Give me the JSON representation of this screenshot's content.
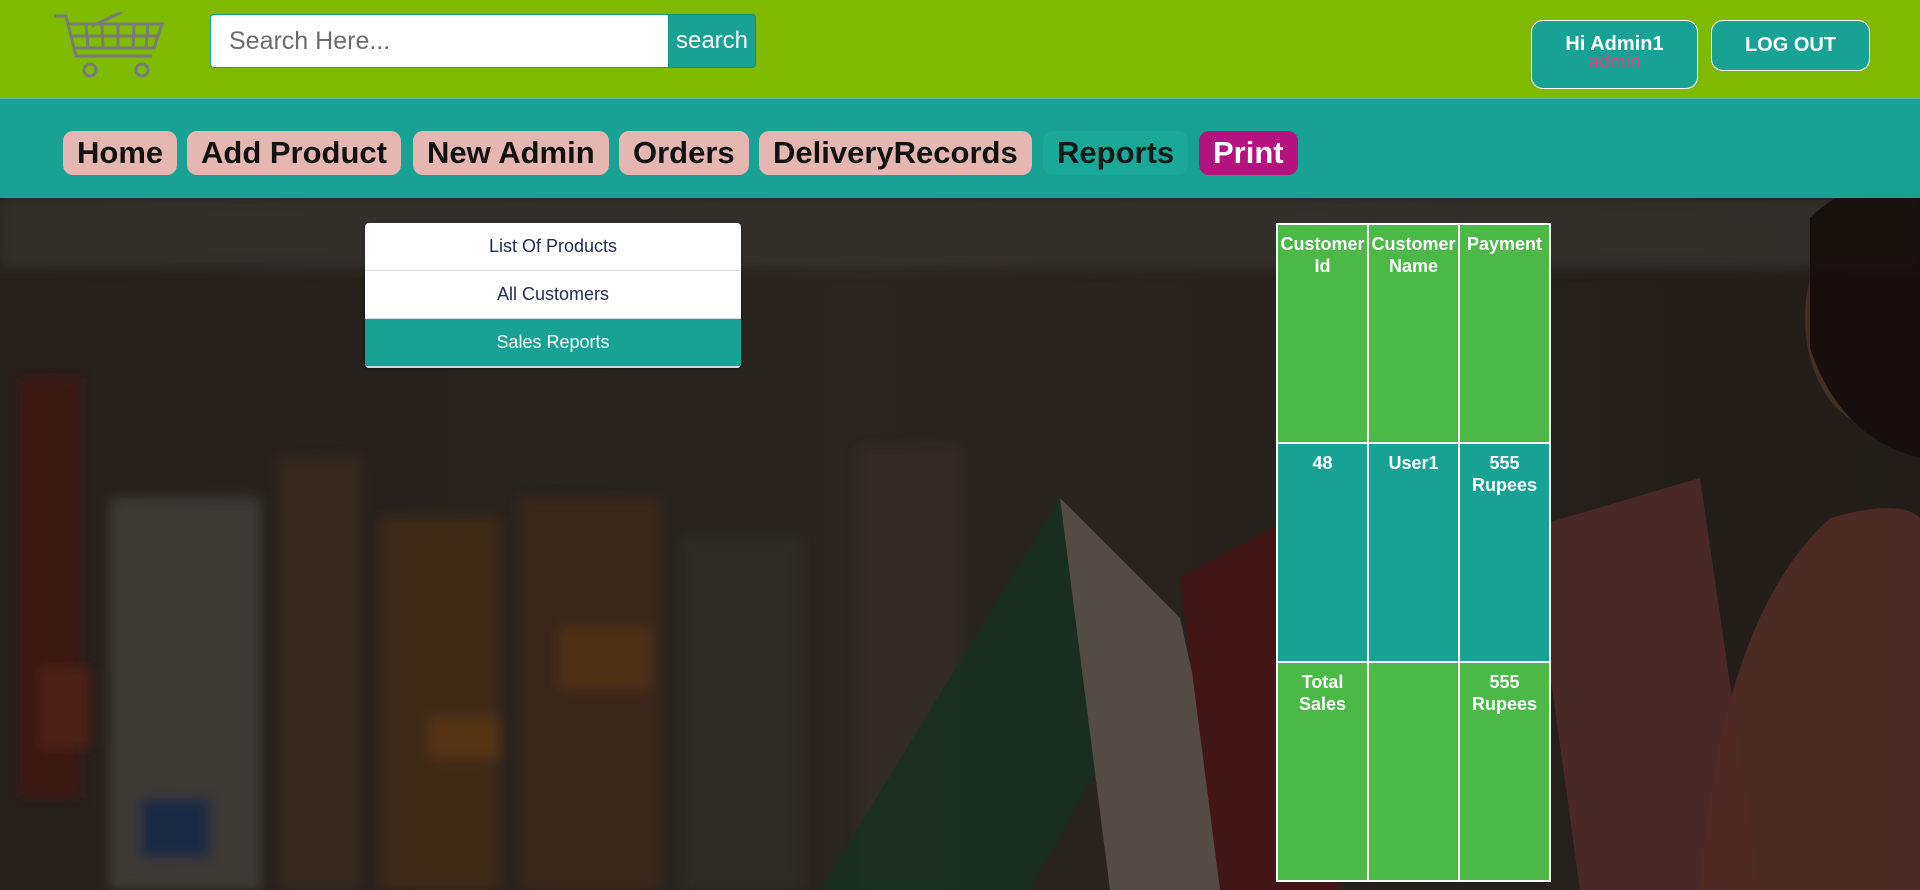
{
  "header": {
    "logo_icon": "shopping-cart-icon",
    "search_placeholder": "Search Here...",
    "search_button": "search",
    "user_greeting": "Hi Admin1",
    "user_role": "admin",
    "logout_label": "LOG OUT"
  },
  "nav": {
    "items": [
      {
        "label": "Home"
      },
      {
        "label": "Add Product"
      },
      {
        "label": "New Admin"
      },
      {
        "label": "Orders"
      },
      {
        "label": "DeliveryRecords"
      },
      {
        "label": "Reports"
      },
      {
        "label": "Print"
      }
    ],
    "active": "Reports"
  },
  "reports_menu": {
    "items": [
      {
        "label": "List Of Products"
      },
      {
        "label": "All Customers"
      },
      {
        "label": "Sales Reports"
      }
    ],
    "selected": "Sales Reports"
  },
  "sales_table": {
    "headers": [
      "Customer Id",
      "Customer Name",
      "Payment"
    ],
    "rows": [
      {
        "customer_id": "48",
        "customer_name": "User1",
        "payment": "555 Rupees"
      }
    ],
    "total_label": "Total Sales",
    "total_value": "555 Rupees"
  },
  "colors": {
    "header_green": "#7fba00",
    "teal": "#17a293",
    "nav_pill": "#e6b6b2",
    "print_magenta": "#b3127f",
    "table_green": "#4cb848",
    "role_pink": "#e0447f"
  }
}
